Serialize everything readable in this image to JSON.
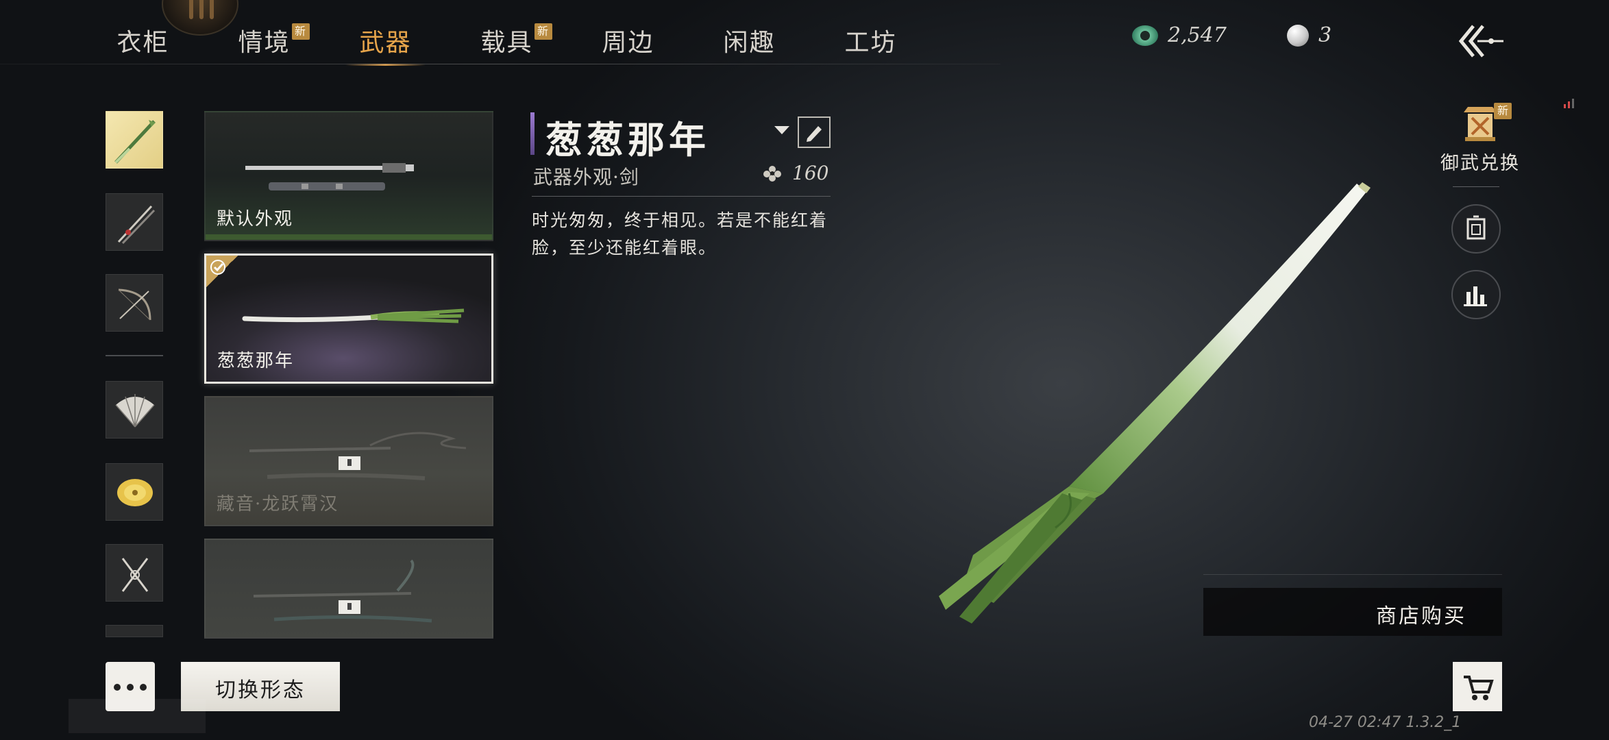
{
  "nav": {
    "tabs": [
      {
        "label": "衣柜",
        "new": false,
        "active": false
      },
      {
        "label": "情境",
        "new": true,
        "active": false
      },
      {
        "label": "武器",
        "new": false,
        "active": true
      },
      {
        "label": "载具",
        "new": true,
        "active": false
      },
      {
        "label": "周边",
        "new": false,
        "active": false
      },
      {
        "label": "闲趣",
        "new": false,
        "active": false
      },
      {
        "label": "工坊",
        "new": false,
        "active": false
      }
    ],
    "new_badge": "新"
  },
  "currency": {
    "jade_amount": "2,547",
    "pearl_amount": "3"
  },
  "weapon_cards": [
    {
      "label": "默认外观",
      "locked": false,
      "selected": false
    },
    {
      "label": "葱葱那年",
      "locked": false,
      "selected": true
    },
    {
      "label": "藏音·龙跃霄汉",
      "locked": true,
      "selected": false
    },
    {
      "label": "",
      "locked": true,
      "selected": false
    }
  ],
  "detail": {
    "title": "葱葱那年",
    "subtitle": "武器外观·剑",
    "score": "160",
    "description": "时光匆匆，终于相见。若是不能红着脸，至少还能红着眼。"
  },
  "side": {
    "exchange_label": "御武兑换",
    "exchange_badge": "新"
  },
  "buttons": {
    "shop_buy": "商店购买",
    "switch_form": "切换形态"
  },
  "footer": {
    "version": "04-27 02:47 1.3.2_1"
  },
  "colors": {
    "accent_gold": "#e6a44a",
    "badge": "#b88a3f",
    "title_bar": "#9b7ad0"
  }
}
